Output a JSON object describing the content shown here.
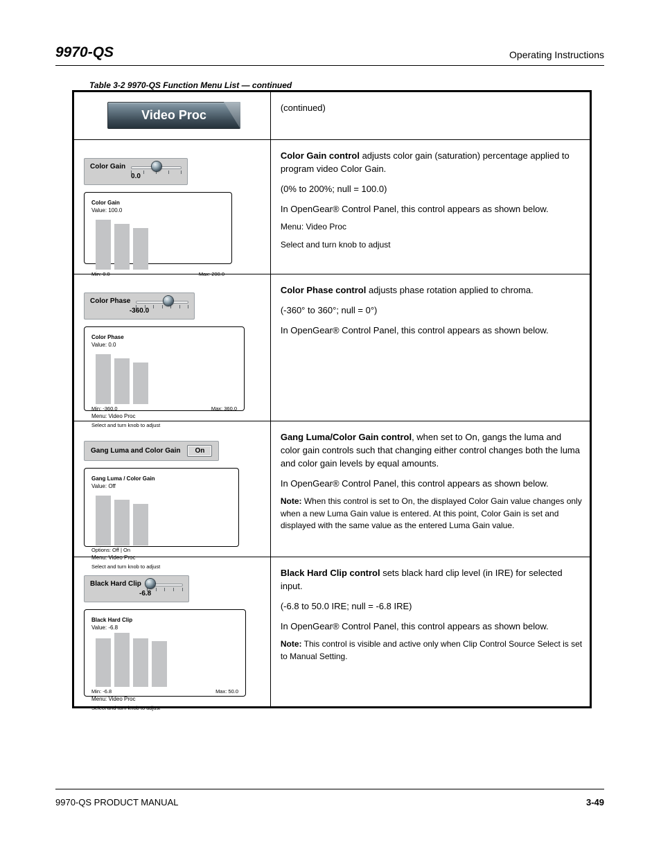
{
  "header": {
    "left": "9970-QS",
    "right": "Operating Instructions"
  },
  "footer": {
    "left": "9970-QS PRODUCT MANUAL",
    "right": "3-49"
  },
  "tableCaption": "Table 3-2  9970-QS Function Menu List — continued",
  "tab": {
    "label": "Video Proc",
    "rightHeader": "(continued)"
  },
  "rows": {
    "colorGain": {
      "slider": {
        "label": "Color Gain",
        "value": "0.0"
      },
      "desc": {
        "title": "Color Gain control",
        "text": " adjusts color gain (saturation) percentage applied to program video Color Gain.",
        "range": "(0% to 200%; null = 100.0)"
      },
      "ogp": {
        "intro": "In OpenGear® Control Panel, this control appears as shown below.",
        "title": "Color Gain",
        "sub": "Value: 100.0",
        "menu": "Menu: Video Proc",
        "hint": "Select and turn knob to adjust",
        "footL": "Min: 0.0",
        "footR": "Max: 200.0"
      }
    },
    "colorPhase": {
      "slider": {
        "label": "Color Phase",
        "value": "-360.0"
      },
      "desc": {
        "title": "Color Phase control",
        "text": " adjusts phase rotation applied to chroma.",
        "range": "(-360° to 360°; null = 0°)"
      },
      "ogp": {
        "intro": "In OpenGear® Control Panel, this control appears as shown below.",
        "title": "Color Phase",
        "sub": "Value: 0.0",
        "menu": "Menu: Video Proc",
        "hint": "Select and turn knob to adjust",
        "footL": "Min: -360.0",
        "footR": "Max: 360.0"
      }
    },
    "gang": {
      "toggle": {
        "label": "Gang Luma and Color Gain",
        "value": "On"
      },
      "desc": {
        "title": "Gang Luma/Color Gain control",
        "text": ", when set to On, gangs the luma and color gain controls such that changing either control changes both the luma and color gain levels by equal amounts.",
        "note": {
          "label": "Note:",
          "text": " When this control is set to On, the displayed Color Gain value changes only when a new Luma Gain value is entered. At this point, Color Gain is set and displayed with the same value as the entered Luma Gain value."
        }
      },
      "ogp": {
        "intro": "In OpenGear® Control Panel, this control appears as shown below.",
        "title": "Gang Luma / Color Gain",
        "sub": "Value: Off",
        "menu": "Menu: Video Proc",
        "hint": "Select and turn knob to adjust",
        "footL": "Options: Off | On",
        "footR": ""
      }
    },
    "blackHardClip": {
      "slider": {
        "label": "Black Hard Clip",
        "value": "-6.8"
      },
      "desc": {
        "title": "Black Hard Clip control",
        "text": " sets black hard clip level (in IRE) for selected input.",
        "range": "(-6.8 to 50.0 IRE; null = -6.8 IRE)",
        "note": {
          "label": "Note:",
          "text": " This control is visible and active only when Clip Control Source Select is set to Manual Setting."
        }
      },
      "ogp": {
        "intro": "In OpenGear® Control Panel, this control appears as shown below.",
        "title": "Black Hard Clip",
        "sub": "Value: -6.8",
        "menu": "Menu: Video Proc",
        "hint": "Select and turn knob to adjust",
        "footL": "Min: -6.8",
        "footR": "Max: 50.0"
      }
    }
  }
}
